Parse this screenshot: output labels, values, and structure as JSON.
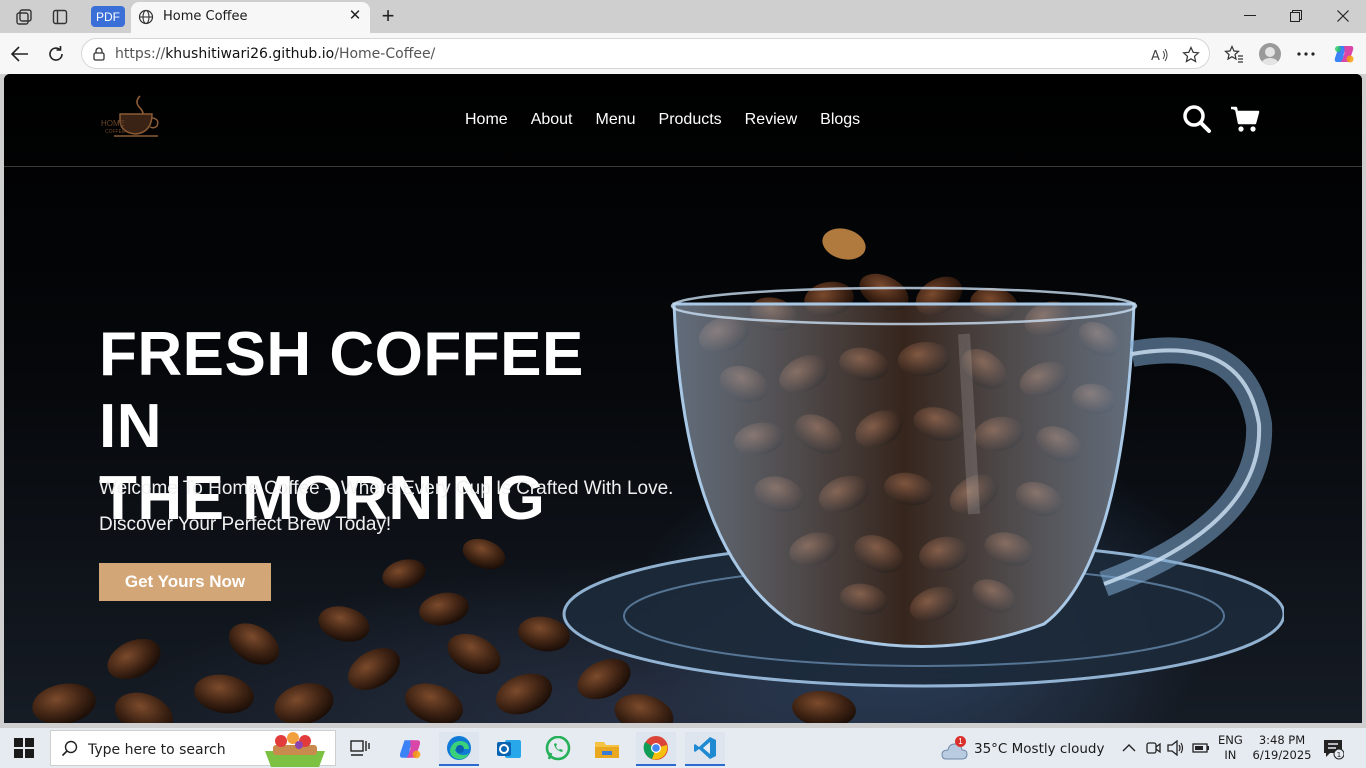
{
  "browser": {
    "pdf_tab_label": "PDF",
    "tab_title": "Home Coffee",
    "url_prefix": "https://",
    "url_host": "khushitiwari26.github.io",
    "url_path": "/Home-Coffee/"
  },
  "site": {
    "logo_text": "HOME COFFEE",
    "nav": [
      "Home",
      "About",
      "Menu",
      "Products",
      "Review",
      "Blogs"
    ],
    "hero": {
      "title_line1": "FRESH COFFEE IN",
      "title_line2": "THE MORNING",
      "subtitle_line1": "Welcome To Home Coffee – Where Every Cup Is Crafted With Love.",
      "subtitle_line2": "Discover Your Perfect Brew Today!",
      "cta_label": "Get Yours Now"
    },
    "colors": {
      "accent": "#d3a677",
      "background": "#000000",
      "text": "#ffffff"
    }
  },
  "taskbar": {
    "search_placeholder": "Type here to search",
    "weather_temp": "35°C  Mostly cloudy",
    "weather_badge": "1",
    "lang_line1": "ENG",
    "lang_line2": "IN",
    "time": "3:48 PM",
    "date": "6/19/2025",
    "notification_count": "1"
  }
}
